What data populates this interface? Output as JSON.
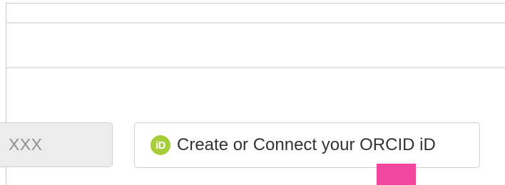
{
  "orcid_input": {
    "value": "XXX"
  },
  "orcid_button": {
    "icon_text": "iD",
    "label": "Create or Connect your ORCID iD"
  },
  "colors": {
    "orcid_green": "#a6ce39",
    "marker_pink": "#f2479e",
    "input_background": "#ececec"
  }
}
